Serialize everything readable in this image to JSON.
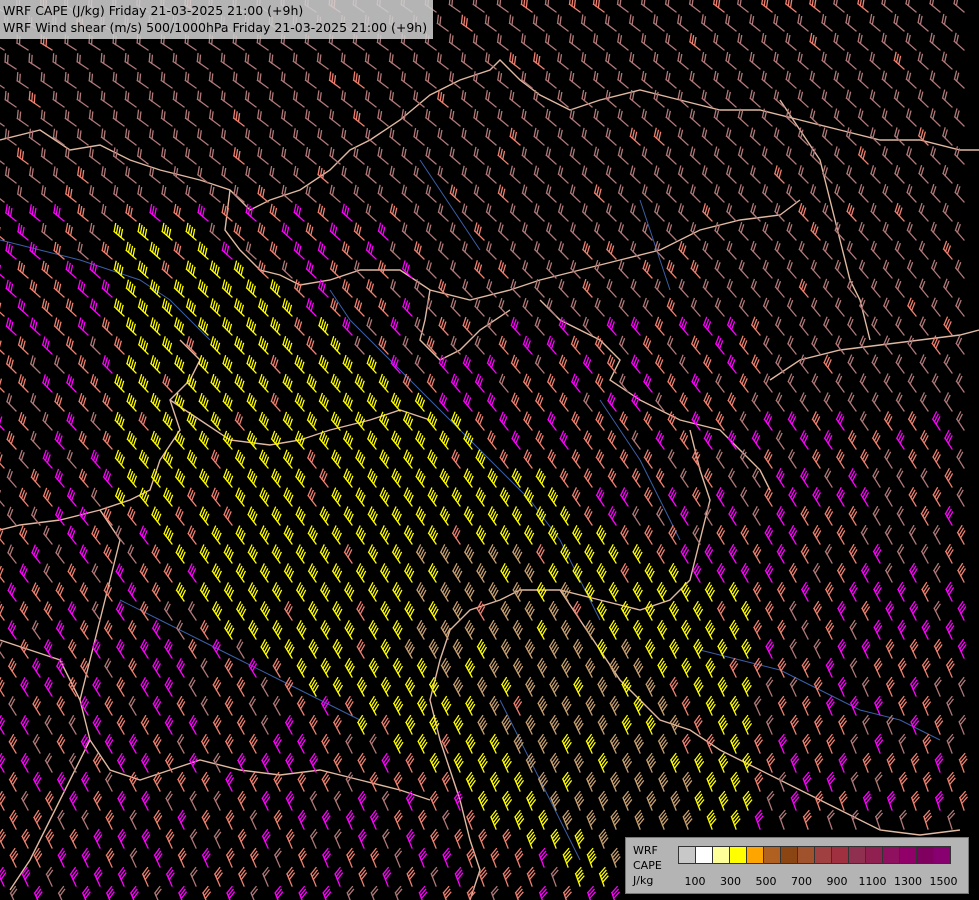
{
  "map": {
    "title_lines": [
      "WRF CAPE (J/kg) Friday 21-03-2025 21:00 (+9h)",
      "WRF Wind shear (m/s) 500/1000hPa Friday 21-03-2025 21:00 (+9h)"
    ],
    "background_color": "#000000",
    "border_color": "#e0b8a0",
    "river_color": "#3a5fa8",
    "barb_colors": {
      "low": "#b07878",
      "mid": "#f08070",
      "high": "#ff00ff",
      "yellow": "#ffff00",
      "tan": "#c8a070"
    }
  },
  "legend": {
    "labels": [
      "WRF",
      "CAPE",
      "J/kg"
    ],
    "swatch_colors": [
      "#c8c8c8",
      "#ffffff",
      "#ffff99",
      "#ffff00",
      "#ffa500",
      "#b06020",
      "#8b4513",
      "#a0522d",
      "#a04040",
      "#a03040",
      "#903050",
      "#902050",
      "#901060",
      "#900068",
      "#800060",
      "#880070"
    ],
    "tick_labels": [
      "100",
      "300",
      "500",
      "700",
      "900",
      "1100",
      "1300",
      "1500"
    ]
  }
}
